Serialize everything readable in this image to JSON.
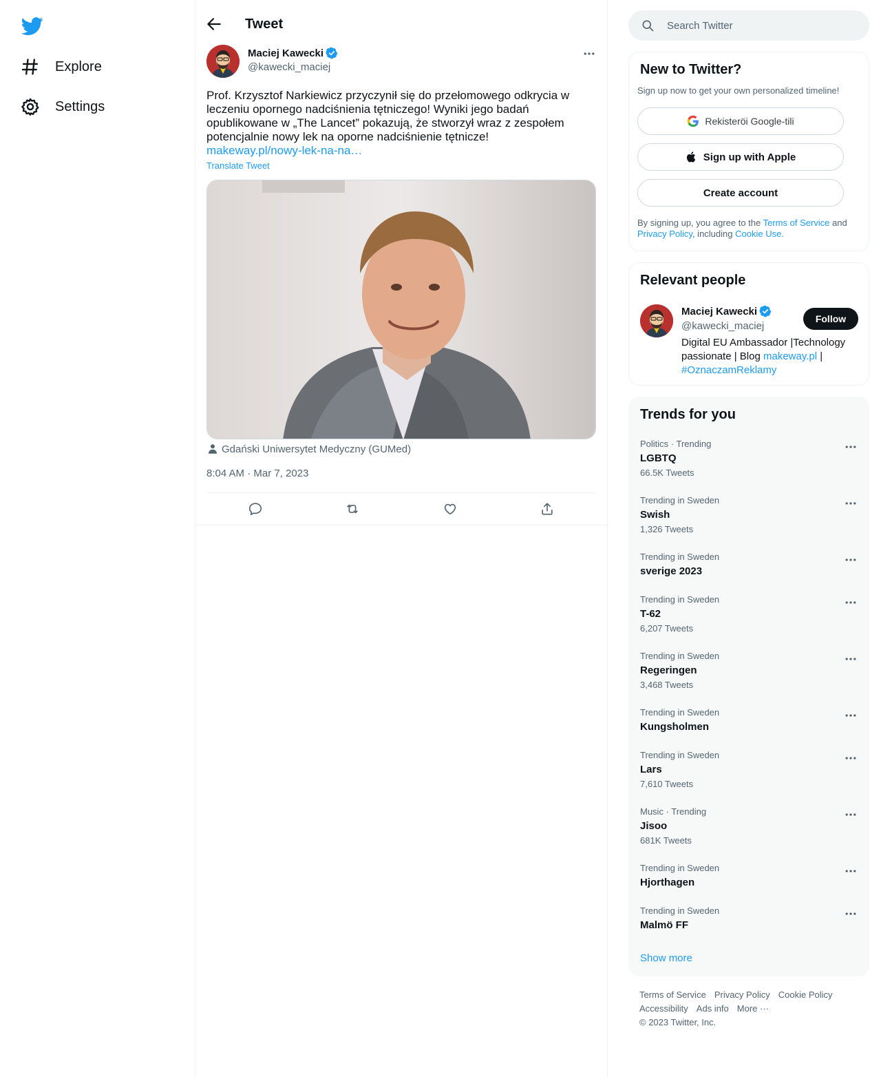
{
  "nav": {
    "explore": "Explore",
    "settings": "Settings"
  },
  "header": {
    "title": "Tweet"
  },
  "tweet": {
    "author_name": "Maciej Kawecki",
    "author_handle": "@kawecki_maciej",
    "text": "Prof. Krzysztof Narkiewicz przyczynił się do przełomowego odkrycia w leczeniu opornego nadciśnienia tętniczego! Wyniki jego badań opublikowane w „The Lancet” pokazują, że stworzył wraz z zespołem potencjalnie nowy lek na oporne nadciśnienie tętnicze!",
    "link": "makeway.pl/nowy-lek-na-na…",
    "translate": "Translate Tweet",
    "media_credit": "Gdański Uniwersytet Medyczny (GUMed)",
    "timestamp": "8:04 AM · Mar 7, 2023"
  },
  "search": {
    "placeholder": "Search Twitter"
  },
  "signup": {
    "title": "New to Twitter?",
    "subtitle": "Sign up now to get your own personalized timeline!",
    "google_label": "Rekisteröi Google-tili",
    "apple_label": "Sign up with Apple",
    "create_label": "Create account",
    "legal_prefix": "By signing up, you agree to the ",
    "terms": "Terms of Service",
    "and": " and ",
    "privacy": "Privacy Policy",
    "including": ", including ",
    "cookie": "Cookie Use."
  },
  "people": {
    "title": "Relevant people",
    "name": "Maciej Kawecki",
    "handle": "@kawecki_maciej",
    "follow": "Follow",
    "bio_text": "Digital EU Ambassador |Technology passionate | Blog ",
    "bio_link": "makeway.pl",
    "bio_sep": " |",
    "bio_tag": "#OznaczamReklamy"
  },
  "trends": {
    "title": "Trends for you",
    "items": [
      {
        "meta": "Politics · Trending",
        "name": "LGBTQ",
        "count": "66.5K Tweets"
      },
      {
        "meta": "Trending in Sweden",
        "name": "Swish",
        "count": "1,326 Tweets"
      },
      {
        "meta": "Trending in Sweden",
        "name": "sverige 2023",
        "count": ""
      },
      {
        "meta": "Trending in Sweden",
        "name": "T-62",
        "count": "6,207 Tweets"
      },
      {
        "meta": "Trending in Sweden",
        "name": "Regeringen",
        "count": "3,468 Tweets"
      },
      {
        "meta": "Trending in Sweden",
        "name": "Kungsholmen",
        "count": ""
      },
      {
        "meta": "Trending in Sweden",
        "name": "Lars",
        "count": "7,610 Tweets"
      },
      {
        "meta": "Music · Trending",
        "name": "Jisoo",
        "count": "681K Tweets"
      },
      {
        "meta": "Trending in Sweden",
        "name": "Hjorthagen",
        "count": ""
      },
      {
        "meta": "Trending in Sweden",
        "name": "Malmö FF",
        "count": ""
      }
    ],
    "show_more": "Show more"
  },
  "footer": {
    "terms": "Terms of Service",
    "privacy": "Privacy Policy",
    "cookie": "Cookie Policy",
    "accessibility": "Accessibility",
    "ads": "Ads info",
    "more": "More ···",
    "copyright": "© 2023 Twitter, Inc."
  },
  "colors": {
    "accent": "#1d9bf0",
    "text": "#0f1419",
    "secondary": "#536471",
    "border": "#eff3f4"
  }
}
